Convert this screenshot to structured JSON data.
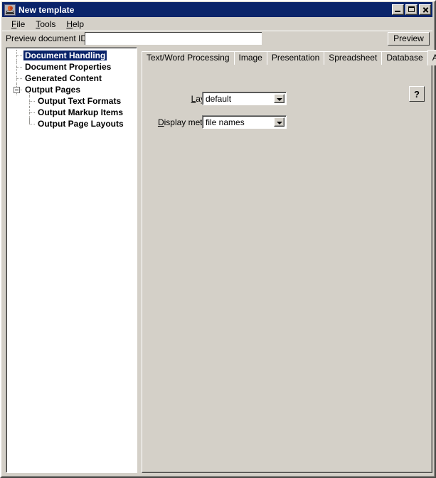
{
  "window": {
    "title": "New template",
    "icon": "java-cup-icon",
    "controls": {
      "minimize": "minimize-button",
      "maximize": "maximize-button",
      "close": "close-button"
    },
    "colors": {
      "titlebar": "#0a246a",
      "face": "#d4d0c8",
      "selection": "#0a246a",
      "field": "#ffffff"
    }
  },
  "menubar": {
    "items": [
      {
        "label": "File",
        "mnemonic": "F",
        "rest": "ile"
      },
      {
        "label": "Tools",
        "mnemonic": "T",
        "rest": "ools"
      },
      {
        "label": "Help",
        "mnemonic": "H",
        "rest": "elp"
      }
    ]
  },
  "toolbar": {
    "preview_id_label": "Preview document ID:",
    "preview_id_value": "",
    "preview_id_placeholder": "",
    "preview_button": "Preview"
  },
  "tree": {
    "items": [
      {
        "label": "Document Handling",
        "level": 0,
        "selected": true,
        "expandable": false,
        "expanded": false
      },
      {
        "label": "Document Properties",
        "level": 0,
        "selected": false,
        "expandable": false,
        "expanded": false
      },
      {
        "label": "Generated Content",
        "level": 0,
        "selected": false,
        "expandable": false,
        "expanded": false
      },
      {
        "label": "Output Pages",
        "level": 0,
        "selected": false,
        "expandable": true,
        "expanded": true
      },
      {
        "label": "Output Text Formats",
        "level": 1,
        "selected": false,
        "expandable": false,
        "expanded": false
      },
      {
        "label": "Output Markup Items",
        "level": 1,
        "selected": false,
        "expandable": false,
        "expanded": false
      },
      {
        "label": "Output Page Layouts",
        "level": 1,
        "selected": false,
        "expandable": false,
        "expanded": false
      }
    ]
  },
  "tabs": {
    "items": [
      {
        "label": "Text/Word Processing",
        "selected": false
      },
      {
        "label": "Image",
        "selected": false
      },
      {
        "label": "Presentation",
        "selected": false
      },
      {
        "label": "Spreadsheet",
        "selected": false
      },
      {
        "label": "Database",
        "selected": false
      },
      {
        "label": "Archive",
        "selected": true
      }
    ],
    "selected": "Archive"
  },
  "panel": {
    "layout": {
      "label": "Layout:",
      "mnemonic": "L",
      "label_prefix": "",
      "label_rest": "ayout:",
      "value": "default",
      "options": [
        "default"
      ]
    },
    "display_method": {
      "label": "Display method:",
      "mnemonic": "D",
      "label_rest": "isplay method:",
      "value": "file names",
      "options": [
        "file names"
      ]
    },
    "help_button": "?"
  }
}
